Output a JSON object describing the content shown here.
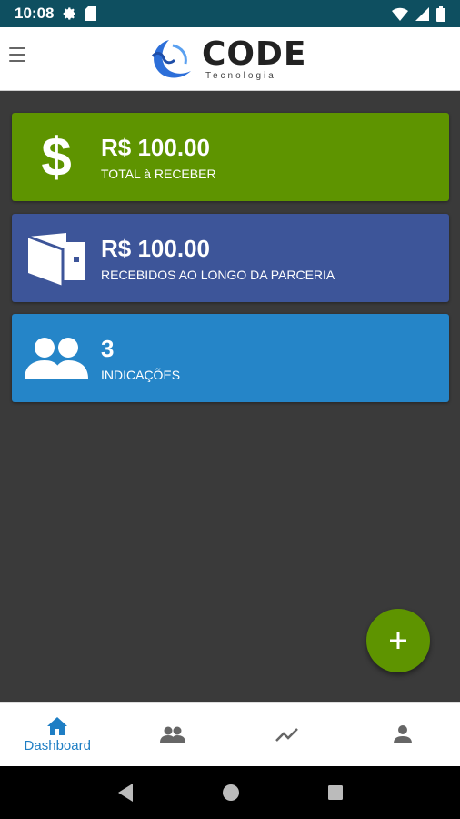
{
  "status_bar": {
    "time": "10:08",
    "icons_left": [
      "gear-icon",
      "sd-card-icon"
    ],
    "icons_right": [
      "wifi-icon",
      "signal-icon",
      "battery-icon"
    ]
  },
  "header": {
    "menu_icon": "hamburger-menu-icon",
    "logo_title": "CODE",
    "logo_subtitle": "Tecnologia"
  },
  "cards": [
    {
      "value": "R$ 100.00",
      "label": "TOTAL à RECEBER",
      "icon": "dollar-icon",
      "color": "#5e9400"
    },
    {
      "value": "R$ 100.00",
      "label": "RECEBIDOS AO LONGO DA PARCERIA",
      "icon": "wallet-icon",
      "color": "#3d5599"
    },
    {
      "value": "3",
      "label": "INDICAÇÕES",
      "icon": "users-icon",
      "color": "#2585c8"
    }
  ],
  "fab": {
    "icon": "plus-icon",
    "color": "#5e9400"
  },
  "bottom_nav": {
    "active_color": "#1e7ec4",
    "items": [
      {
        "icon": "home-icon",
        "label": "Dashboard",
        "active": true
      },
      {
        "icon": "people-icon",
        "label": "",
        "active": false
      },
      {
        "icon": "trending-icon",
        "label": "",
        "active": false
      },
      {
        "icon": "person-icon",
        "label": "",
        "active": false
      }
    ]
  },
  "system_nav": [
    "back-icon",
    "home-circle-icon",
    "recents-icon"
  ]
}
